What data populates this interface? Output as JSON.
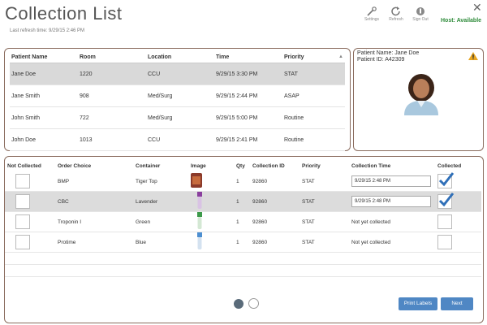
{
  "header": {
    "title": "Collection List",
    "last_refresh": "Last refresh time: 9/29/15 2:46 PM",
    "settings_label": "Settings",
    "refresh_label": "Refresh",
    "signout_label": "Sign Out",
    "host_status": "Host: Available"
  },
  "patients": {
    "columns": [
      "Patient Name",
      "Room",
      "Location",
      "Time",
      "Priority"
    ],
    "rows": [
      [
        "Jane Doe",
        "1220",
        "CCU",
        "9/29/15 3:30 PM",
        "STAT"
      ],
      [
        "Jane Smith",
        "908",
        "Med/Surg",
        "9/29/15 2:44 PM",
        "ASAP"
      ],
      [
        "John Smith",
        "722",
        "Med/Surg",
        "9/29/15 5:00 PM",
        "Routine"
      ],
      [
        "John Doe",
        "1013",
        "CCU",
        "9/29/15 2:41 PM",
        "Routine"
      ]
    ]
  },
  "patient_card": {
    "name": "Patient Name: Jane Doe",
    "id": "Patient ID: A42309"
  },
  "orders": {
    "columns": [
      "Not Collected",
      "Order Choice",
      "Container",
      "Image",
      "Qty",
      "Collection ID",
      "Priority",
      "Collection Time",
      "Collected"
    ],
    "rows": [
      {
        "order": "BMP",
        "container": "Tiger Top",
        "qty": "1",
        "id": "92860",
        "priority": "STAT",
        "time": "9/29/15 2:48 PM",
        "collected": true
      },
      {
        "order": "CBC",
        "container": "Lavender",
        "qty": "1",
        "id": "92860",
        "priority": "STAT",
        "time": "9/29/15 2:48 PM",
        "collected": true
      },
      {
        "order": "Troponin I",
        "container": "Green",
        "qty": "1",
        "id": "92860",
        "priority": "STAT",
        "time": "Not yet collected",
        "collected": false
      },
      {
        "order": "Protime",
        "container": "Blue",
        "qty": "1",
        "id": "92860",
        "priority": "STAT",
        "time": "Not yet collected",
        "collected": false
      }
    ]
  },
  "footer": {
    "print_label": "Print Labels",
    "next_label": "Next"
  },
  "colors": {
    "accent": "#4f87c4",
    "host_ok": "#2e8b3a",
    "panel_border": "#8a6c5e"
  }
}
